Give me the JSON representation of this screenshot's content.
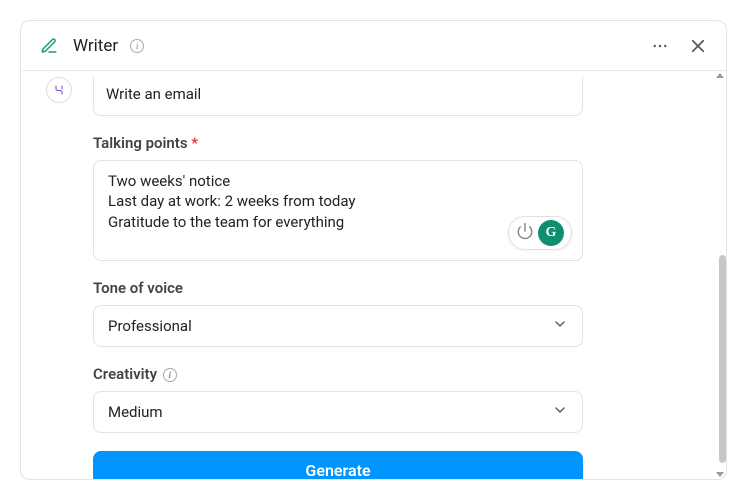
{
  "header": {
    "title": "Writer"
  },
  "form": {
    "type_label": "Write an email",
    "talking_points": {
      "label": "Talking points",
      "value": "Two weeks' notice\nLast day at work: 2 weeks from today\nGratitude to the team for everything"
    },
    "tone": {
      "label": "Tone of voice",
      "value": "Professional"
    },
    "creativity": {
      "label": "Creativity",
      "value": "Medium"
    },
    "submit_label": "Generate"
  }
}
